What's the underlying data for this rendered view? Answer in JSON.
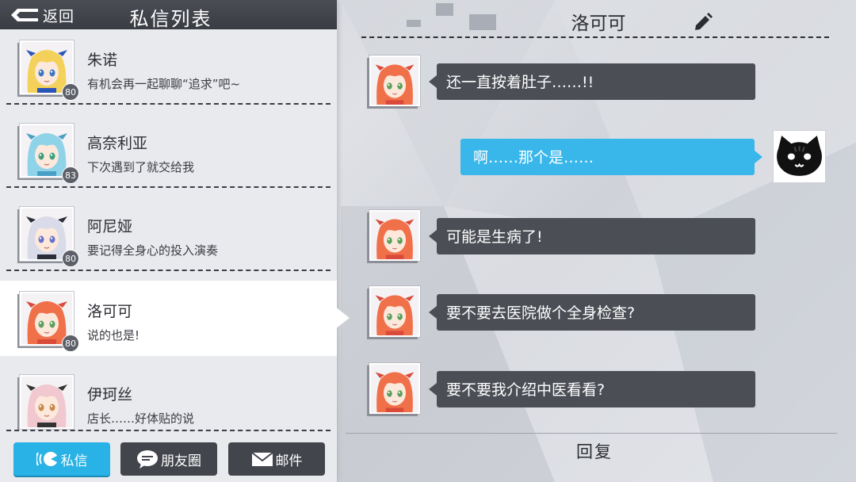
{
  "header": {
    "back_label": "返回",
    "title": "私信列表"
  },
  "contacts": [
    {
      "name": "朱诺",
      "message": "有机会再一起聊聊“追求”吧~",
      "level": "80",
      "hair": "#f4d15a",
      "eyes": "#3a77c4",
      "accent": "#2c55b8"
    },
    {
      "name": "高奈利亚",
      "message": "下次遇到了就交给我",
      "level": "83",
      "hair": "#8fd3e8",
      "eyes": "#3aa07a",
      "accent": "#4a9fc4"
    },
    {
      "name": "阿尼娅",
      "message": "要记得全身心的投入演奏",
      "level": "80",
      "hair": "#d9dbe8",
      "eyes": "#6a72c8",
      "accent": "#2b2d3a"
    },
    {
      "name": "洛可可",
      "message": "说的也是!",
      "level": "80",
      "hair": "#f0704a",
      "eyes": "#5aa05a",
      "accent": "#d94a3a"
    },
    {
      "name": "伊珂丝",
      "message": "店长……好体贴的说",
      "level": "",
      "hair": "#f1c8cf",
      "eyes": "#c7894a",
      "accent": "#333333"
    }
  ],
  "tabs": {
    "dm_label": "私信",
    "friends_label": "朋友圈",
    "mail_label": "邮件"
  },
  "chat": {
    "title": "洛可可",
    "messages": [
      {
        "from": "洛可可",
        "text": "还一直按着肚子……!!"
      },
      {
        "from": "me",
        "text": "啊……那个是……"
      },
      {
        "from": "洛可可",
        "text": "可能是生病了!"
      },
      {
        "from": "洛可可",
        "text": "要不要去医院做个全身检查?"
      },
      {
        "from": "洛可可",
        "text": "要不要我介绍中医看看?"
      }
    ],
    "reply_label": "回复"
  },
  "colors": {
    "accent": "#29b2e6",
    "dark_panel": "#42454c",
    "bubble_in": "#4b4e55",
    "bubble_out": "#39b7ea"
  }
}
